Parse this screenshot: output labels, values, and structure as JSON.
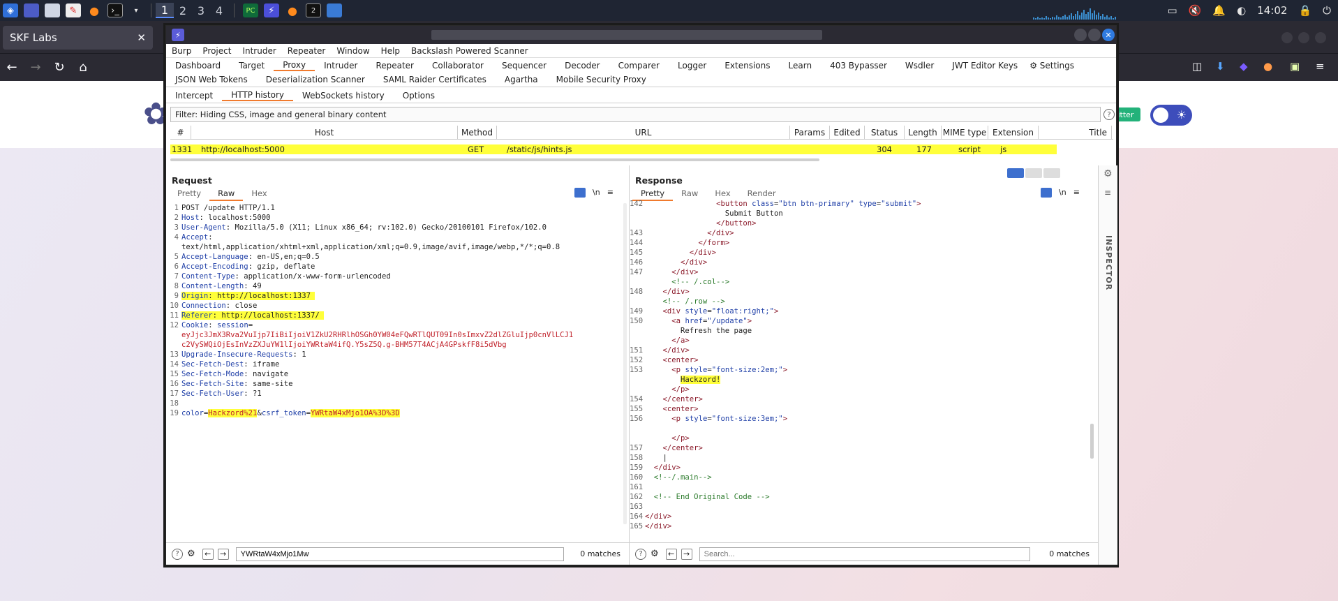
{
  "taskbar": {
    "workspaces": [
      "1",
      "2",
      "3",
      "4"
    ],
    "active_workspace": "1",
    "clock": "14:02"
  },
  "browser": {
    "tab_title": "SKF Labs",
    "page": {
      "twitter_label": "itter"
    }
  },
  "burp": {
    "menu": [
      "Burp",
      "Project",
      "Intruder",
      "Repeater",
      "Window",
      "Help",
      "Backslash Powered Scanner"
    ],
    "tabs_row1": [
      "Dashboard",
      "Target",
      "Proxy",
      "Intruder",
      "Repeater",
      "Collaborator",
      "Sequencer",
      "Decoder",
      "Comparer",
      "Logger",
      "Extensions",
      "Learn",
      "403 Bypasser",
      "Wsdler",
      "JWT Editor Keys"
    ],
    "settings_label": "Settings",
    "tabs_row2": [
      "JSON Web Tokens",
      "Deserialization Scanner",
      "SAML Raider Certificates",
      "Agartha",
      "Mobile Security Proxy"
    ],
    "proxy_tabs": [
      "Intercept",
      "HTTP history",
      "WebSockets history",
      "Options"
    ],
    "filter_text": "Filter: Hiding CSS, image and general binary content",
    "table_headers": [
      "#",
      "Host",
      "Method",
      "URL",
      "Params",
      "Edited",
      "Status",
      "Length",
      "MIME type",
      "Extension",
      "Title"
    ],
    "selected_row": {
      "num": "1331",
      "host": "http://localhost:5000",
      "method": "GET",
      "url": "/static/js/hints.js",
      "status": "304",
      "length": "177",
      "mime": "script",
      "ext": "js"
    },
    "request": {
      "title": "Request",
      "tabs": [
        "Pretty",
        "Raw",
        "Hex"
      ],
      "search_value": "YWRtaW4xMjo1Mw",
      "matches": "0 matches"
    },
    "response": {
      "title": "Response",
      "tabs": [
        "Pretty",
        "Raw",
        "Hex",
        "Render"
      ],
      "search_placeholder": "Search...",
      "matches": "0 matches"
    },
    "inspector_label": "INSPECTOR",
    "newline_label": "\\n"
  }
}
